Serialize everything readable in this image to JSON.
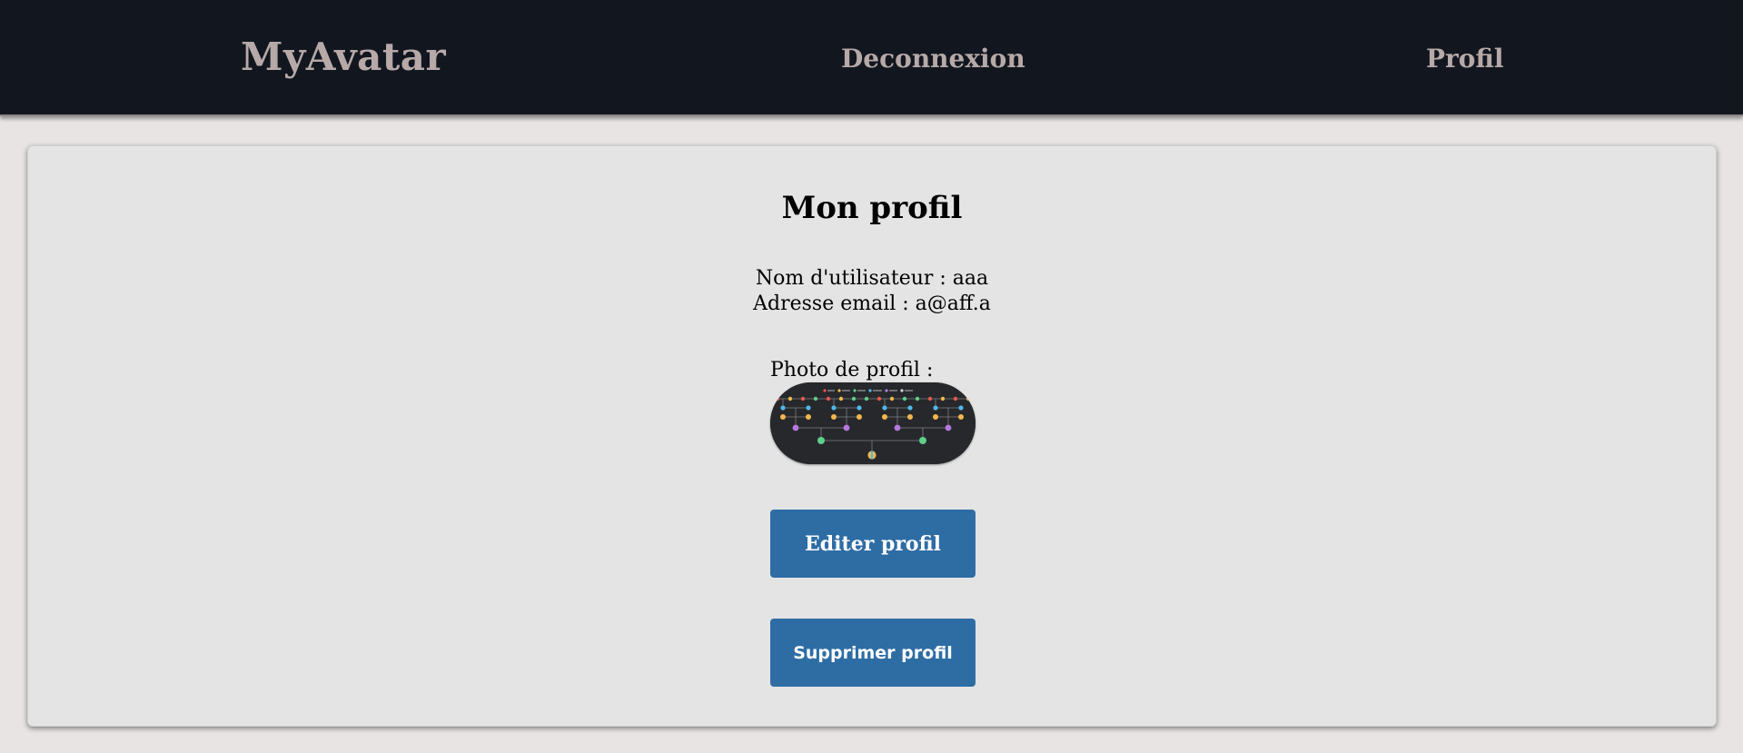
{
  "nav": {
    "brand": "MyAvatar",
    "logout_label": "Deconnexion",
    "profile_label": "Profil"
  },
  "profile": {
    "title": "Mon profil",
    "username_line": "Nom d'utilisateur : aaa",
    "email_line": "Adresse email : a@aff.a",
    "photo_label": "Photo de profil :",
    "edit_label": "Editer profil",
    "delete_label": "Supprimer profil"
  },
  "colors": {
    "navbar_bg": "#12161f",
    "nav_text": "#b6a9a8",
    "button_bg": "#2e6da4",
    "card_bg": "#e4e4e4"
  }
}
